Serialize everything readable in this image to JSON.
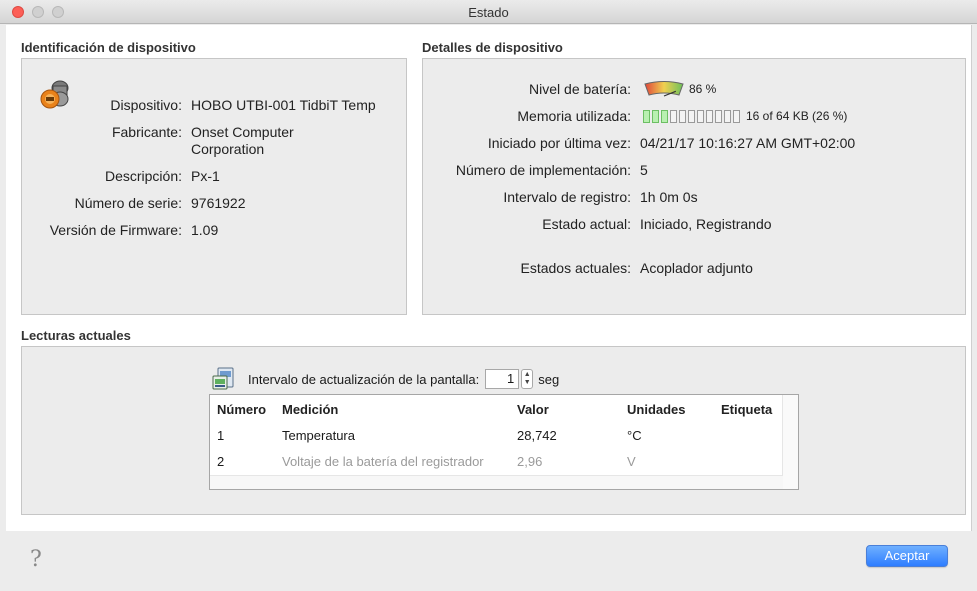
{
  "window": {
    "title": "Estado"
  },
  "background_strip": [
    "1",
    "1",
    "1",
    "2",
    "2",
    "2",
    "2"
  ],
  "device_identification": {
    "section_title": "Identificación de dispositivo",
    "fields": [
      {
        "label": "Dispositivo:",
        "value": "HOBO UTBI-001 TidbiT Temp"
      },
      {
        "label": "Fabricante:",
        "value_line1": "Onset Computer",
        "value_line2": "Corporation"
      },
      {
        "label": "Descripción:",
        "value": "Px-1"
      },
      {
        "label": "Número de serie:",
        "value": "9761922"
      },
      {
        "label": "Versión de Firmware:",
        "value": "1.09"
      }
    ]
  },
  "device_details": {
    "section_title": "Detalles de dispositivo",
    "battery": {
      "label": "Nivel de batería:",
      "value": "86 %",
      "level": 0.86
    },
    "memory": {
      "label": "Memoria utilizada:",
      "value": "16 of 64 KB (26 %)",
      "used_fraction": 0.26,
      "segments_total": 11,
      "segments_used": 3
    },
    "fields": [
      {
        "label": "Iniciado por última vez:",
        "value": "04/21/17 10:16:27 AM GMT+02:00"
      },
      {
        "label": "Número de implementación:",
        "value": "5"
      },
      {
        "label": "Intervalo de registro:",
        "value": "1h 0m 0s"
      },
      {
        "label": "Estado actual:",
        "value": "Iniciado, Registrando"
      },
      {
        "label": "Estados actuales:",
        "value": "Acoplador adjunto"
      }
    ]
  },
  "current_readings": {
    "section_title": "Lecturas actuales",
    "refresh_label": "Intervalo de actualización de la pantalla:",
    "refresh_value": "1",
    "refresh_unit": "seg",
    "columns": [
      "Número",
      "Medición",
      "Valor",
      "Unidades",
      "Etiqueta"
    ],
    "rows": [
      {
        "num": "1",
        "measure": "Temperatura",
        "value": "28,742",
        "units": "°C",
        "label": "",
        "dim": false
      },
      {
        "num": "2",
        "measure": "Voltaje de la batería del registrador",
        "value": "2,96",
        "units": "V",
        "label": "",
        "dim": true
      }
    ]
  },
  "footer": {
    "help_glyph": "?",
    "accept_label": "Aceptar"
  },
  "colors": {
    "accent": "#2e7dff",
    "close": "#fc5f57",
    "memory_used": "#b8f0b0"
  }
}
